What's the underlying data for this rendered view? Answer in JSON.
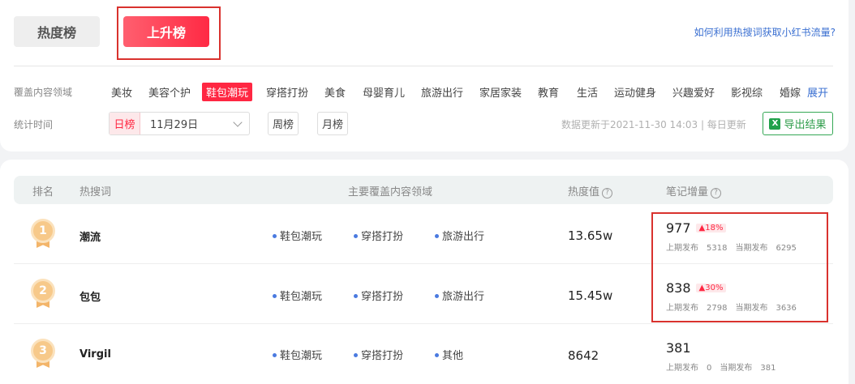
{
  "tabs": {
    "hot": "热度榜",
    "rising": "上升榜"
  },
  "help_link": "如何利用热搜词获取小红书流量?",
  "filters": {
    "category_label": "覆盖内容领域",
    "categories": [
      "美妆",
      "美容个护",
      "鞋包潮玩",
      "穿搭打扮",
      "美食",
      "母婴育儿",
      "旅游出行",
      "家居家装",
      "教育",
      "生活",
      "运动健身",
      "兴趣爱好",
      "影视综",
      "婚嫁"
    ],
    "active_category": "鞋包潮玩",
    "expand": "展开",
    "time_label": "统计时间",
    "day_tag": "日榜",
    "date_value": "11月29日",
    "week": "周榜",
    "month": "月榜",
    "update_text": "数据更新于2021-11-30 14:03 | 每日更新",
    "export": "导出结果",
    "export_icon": "X"
  },
  "table": {
    "headers": {
      "rank": "排名",
      "keyword": "热搜词",
      "domain": "主要覆盖内容领域",
      "heat": "热度值",
      "notes": "笔记增量"
    },
    "help_icon": "?",
    "rows": [
      {
        "rank": "1",
        "keyword": "潮流",
        "domains": [
          "鞋包潮玩",
          "穿搭打扮",
          "旅游出行"
        ],
        "heat": "13.65w",
        "notes": "977",
        "growth": "▲18%",
        "prev_label": "上期发布",
        "prev": "5318",
        "cur_label": "当期发布",
        "cur": "6295"
      },
      {
        "rank": "2",
        "keyword": "包包",
        "domains": [
          "鞋包潮玩",
          "穿搭打扮",
          "旅游出行"
        ],
        "heat": "15.45w",
        "notes": "838",
        "growth": "▲30%",
        "prev_label": "上期发布",
        "prev": "2798",
        "cur_label": "当期发布",
        "cur": "3636"
      },
      {
        "rank": "3",
        "keyword": "Virgil",
        "domains": [
          "鞋包潮玩",
          "穿搭打扮",
          "其他"
        ],
        "heat": "8642",
        "notes": "381",
        "growth": "",
        "prev_label": "上期发布",
        "prev": "0",
        "cur_label": "当期发布",
        "cur": "381"
      }
    ]
  },
  "colors": {
    "accent": "#ff2742",
    "highlight_box": "#d9322e",
    "link": "#3a6fd1",
    "export_green": "#2e9c4a"
  }
}
